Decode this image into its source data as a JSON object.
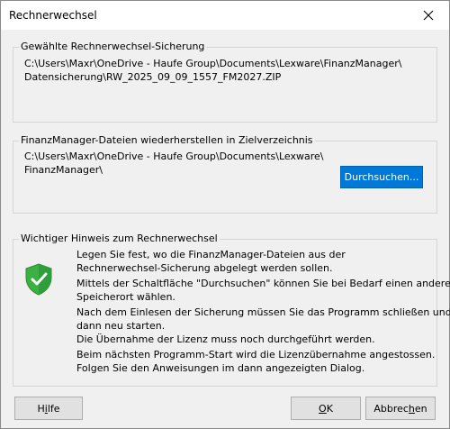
{
  "window": {
    "title": "Rechnerwechsel"
  },
  "backup_group": {
    "label": "Gewählte Rechnerwechsel-Sicherung",
    "path_line1": "C:\\Users\\Maxr\\OneDrive - Haufe Group\\Documents\\Lexware\\FinanzManager\\",
    "path_line2": "Datensicherung\\RW_2025_09_09_1557_FM2027.ZIP"
  },
  "restore_group": {
    "label": "FinanzManager-Dateien wiederherstellen in Zielverzeichnis",
    "path_line1": "C:\\Users\\Maxr\\OneDrive - Haufe Group\\Documents\\Lexware\\",
    "path_line2": "FinanzManager\\",
    "browse_label": "Durchsuchen..."
  },
  "notice_group": {
    "label": "Wichtiger Hinweis zum Rechnerwechsel",
    "p1_line1": "Legen Sie fest, wo die FinanzManager-Dateien aus der",
    "p1_line2": "Rechnerwechsel-Sicherung abgelegt werden sollen.",
    "p2_line1": "Mittels der Schaltfläche \"Durchsuchen\" können Sie bei Bedarf einen anderen",
    "p2_line2": "Speicherort wählen.",
    "p3_line1": "Nach dem Einlesen der Sicherung müssen Sie das Programm schließen und",
    "p3_line2": "dann neu starten.",
    "p3_line3": "Die Übernahme der Lizenz muss noch durchgeführt werden.",
    "p4_line1": "Beim nächsten Programm-Start wird die Lizenzübernahme angestossen.",
    "p4_line2": "Folgen Sie den Anweisungen im dann angezeigten Dialog."
  },
  "buttons": {
    "help_pre": "H",
    "help_mnemonic": "i",
    "help_post": "lfe",
    "ok_mnemonic": "O",
    "ok_post": "K",
    "cancel_pre": "Abbrec",
    "cancel_mnemonic": "h",
    "cancel_post": "en"
  },
  "icons": {
    "close": "close-icon",
    "shield": "shield-check-icon"
  },
  "colors": {
    "primary_button": "#0078d7",
    "shield_green": "#3cb043"
  }
}
